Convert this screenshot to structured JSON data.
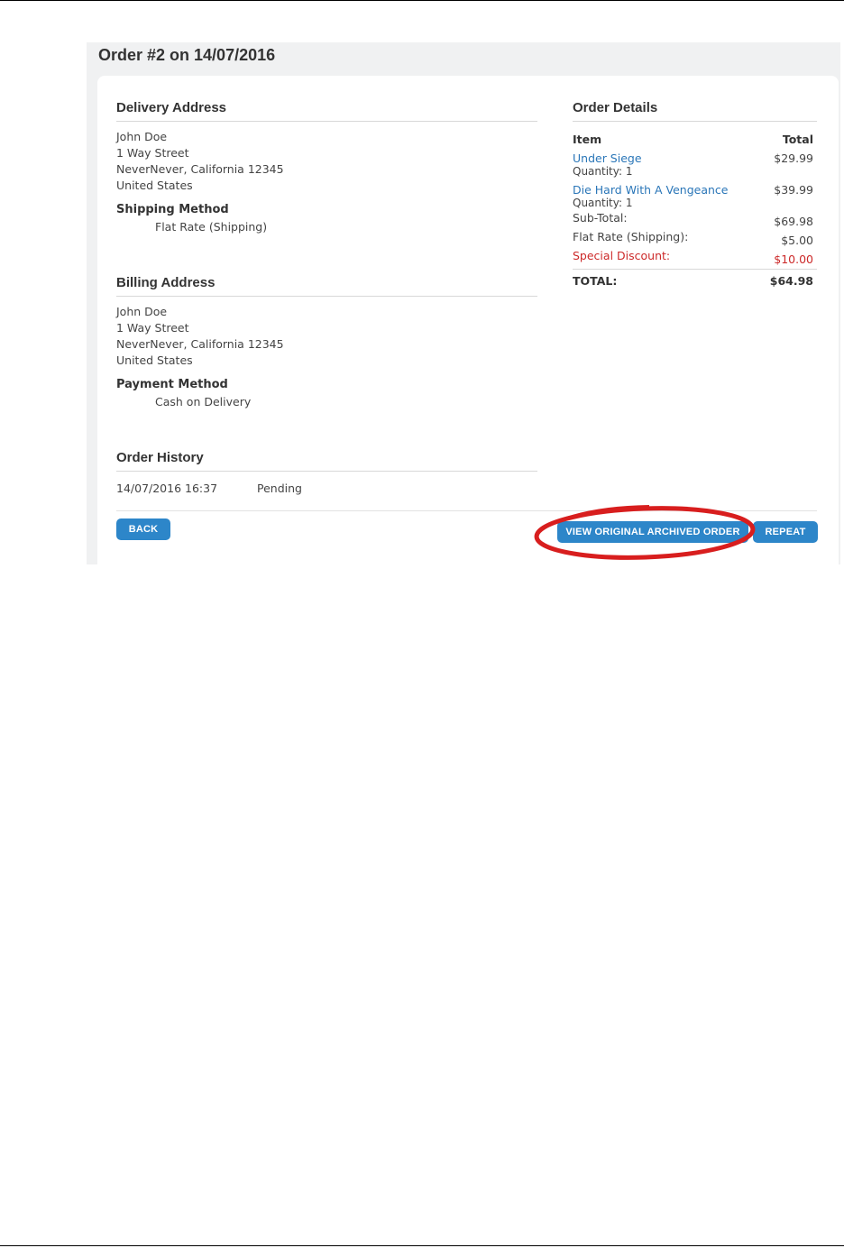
{
  "order": {
    "title": "Order #2 on 14/07/2016"
  },
  "delivery": {
    "heading": "Delivery Address",
    "lines": [
      "John Doe",
      "1 Way Street",
      "NeverNever, California 12345",
      "United States"
    ],
    "method_label": "Shipping Method",
    "method_value": "Flat Rate (Shipping)"
  },
  "billing": {
    "heading": "Billing Address",
    "lines": [
      "John Doe",
      "1 Way Street",
      "NeverNever, California 12345",
      "United States"
    ],
    "method_label": "Payment Method",
    "method_value": "Cash on Delivery"
  },
  "history": {
    "heading": "Order History",
    "rows": [
      {
        "date": "14/07/2016 16:37",
        "status": "Pending"
      }
    ]
  },
  "details": {
    "heading": "Order Details",
    "col_item": "Item",
    "col_total": "Total",
    "items": [
      {
        "name": "Under Siege",
        "qty": "Quantity: 1",
        "price": "$29.99"
      },
      {
        "name": "Die Hard With A Vengeance",
        "qty": "Quantity: 1",
        "price": "$39.99"
      }
    ],
    "subtotal_label": "Sub-Total:",
    "subtotal_value": "$69.98",
    "shipping_label": "Flat Rate (Shipping):",
    "shipping_value": "$5.00",
    "discount_label": "Special Discount:",
    "discount_value": "$10.00",
    "total_label": "TOTAL:",
    "total_value": "$64.98"
  },
  "buttons": {
    "back": "BACK",
    "view_archived": "VIEW ORIGINAL ARCHIVED ORDER",
    "repeat": "REPEAT"
  },
  "colors": {
    "link": "#2a76b8",
    "button": "#2d86c9",
    "discount": "#cc2929",
    "annotation": "#d81e1e"
  }
}
